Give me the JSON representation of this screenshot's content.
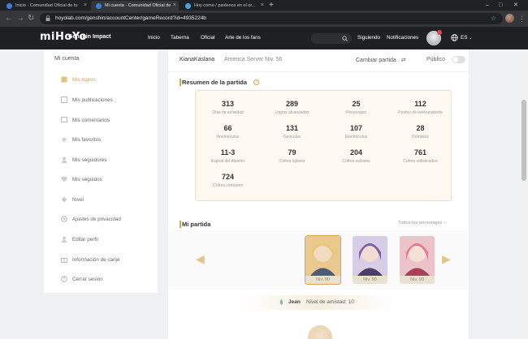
{
  "browser": {
    "tabs": [
      {
        "label": "Inicio · Comunidad Oficial de tu"
      },
      {
        "label": "Mi cuenta · Comunidad Oficial de"
      },
      {
        "label": "Hoy como / pavlenos en el or..."
      }
    ],
    "new_tab": "+",
    "url": "hoyolab.com/genshin/accountCenter/gameRecord?id=4935224b",
    "window_controls": [
      "–",
      "□",
      "✕"
    ]
  },
  "header": {
    "logo": "miHoYo",
    "game": "Genshin Impact",
    "nav": [
      "Inicio",
      "Taberna",
      "Oficial",
      "Arte de los fans"
    ],
    "following": "Siguiendo",
    "notifications": "Notificaciones",
    "lang": "ES"
  },
  "sidebar": {
    "title": "Mi cuenta",
    "items": [
      {
        "label": "Mis logros",
        "icon": "trophy-icon",
        "active": true
      },
      {
        "label": "Mis publicaciones",
        "icon": "document-icon"
      },
      {
        "label": "Mis comentarios",
        "icon": "comment-icon"
      },
      {
        "label": "Mis favoritos",
        "icon": "star-icon"
      },
      {
        "label": "Mis seguidores",
        "icon": "followers-icon"
      },
      {
        "label": "Mis seguidos",
        "icon": "heart-icon"
      },
      {
        "label": "Nivel",
        "icon": "level-icon"
      },
      {
        "label": "Ajustes de privacidad",
        "icon": "privacy-icon"
      },
      {
        "label": "Editar perfil",
        "icon": "profile-icon"
      },
      {
        "label": "Información de canje",
        "icon": "gift-icon"
      },
      {
        "label": "Cerrar sesión",
        "icon": "logout-icon"
      }
    ]
  },
  "account": {
    "username": "KianaKaslana",
    "server": "America Server Niv. 56",
    "change_game": "Cambiar partida",
    "public_label": "Público"
  },
  "summary": {
    "title": "Resumen de la partida",
    "stats": [
      {
        "value": "313",
        "label": "Días de actividad"
      },
      {
        "value": "289",
        "label": "Logros alcanzados"
      },
      {
        "value": "25",
        "label": "Personajes"
      },
      {
        "value": "112",
        "label": "Puntos de teletransporte"
      },
      {
        "value": "66",
        "label": "Anemóculus"
      },
      {
        "value": "131",
        "label": "Geóculus"
      },
      {
        "value": "107",
        "label": "Electróculus"
      },
      {
        "value": "28",
        "label": "Dominios"
      },
      {
        "value": "11-3",
        "label": "Espiral del Abismo"
      },
      {
        "value": "79",
        "label": "Cofres lujosos"
      },
      {
        "value": "204",
        "label": "Cofres valiosos"
      },
      {
        "value": "761",
        "label": "Cofres sofisticados"
      },
      {
        "value": "724",
        "label": "Cofres comunes"
      }
    ]
  },
  "my_game": {
    "title": "Mi partida",
    "all_characters": "Todos los personajes",
    "characters": [
      {
        "level": "Niv. 90",
        "color": "#d9b26a"
      },
      {
        "level": "Niv. 90",
        "color": "#8f7bb8"
      },
      {
        "level": "Niv. 90",
        "color": "#d97a8c"
      }
    ],
    "selected_name": "Jean",
    "friendship": "Nivel de amistad: 10"
  },
  "colors": {
    "accent": "#d6a34e",
    "header_bg": "#1f2023",
    "page_bg": "#f0f1f2"
  }
}
